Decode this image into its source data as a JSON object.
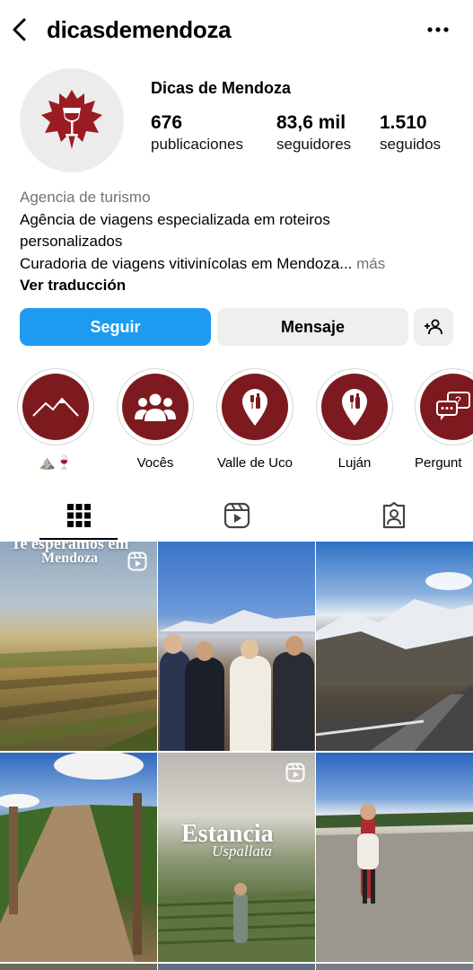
{
  "header": {
    "username": "dicasdemendoza",
    "back_icon": "chevron-left-icon",
    "more_icon": "more-horizontal-icon"
  },
  "profile": {
    "display_name": "Dicas de Mendoza",
    "avatar_icon": "vine-leaf-wine-glass-logo",
    "brand_color": "#9b1c22",
    "stats": {
      "posts_count": "676",
      "posts_label": "publicaciones",
      "followers_count": "83,6 mil",
      "followers_label": "seguidores",
      "following_count": "1.510",
      "following_label": "seguidos"
    },
    "category": "Agencia de turismo",
    "bio_line_1": "Agência de viagens especializada em roteiros",
    "bio_line_2": "personalizados",
    "bio_line_3": "Curadoria de viagens vitivinícolas em Mendoza...",
    "more_label": "más",
    "translate_label": "Ver traducción"
  },
  "actions": {
    "follow_label": "Seguir",
    "follow_color": "#1e9bf0",
    "message_label": "Mensaje",
    "suggest_icon": "add-person-icon"
  },
  "highlights": [
    {
      "label": "⛰️🍷",
      "icon": "mountains-icon"
    },
    {
      "label": "Vocês",
      "icon": "group-icon"
    },
    {
      "label": "Valle de Uco",
      "icon": "map-pin-wine-icon"
    },
    {
      "label": "Luján",
      "icon": "map-pin-wine-icon"
    },
    {
      "label": "Pergunt",
      "icon": "chat-question-icon"
    }
  ],
  "tabs": [
    {
      "name": "posts",
      "icon": "grid-icon",
      "active": true
    },
    {
      "name": "reels",
      "icon": "reels-icon",
      "active": false
    },
    {
      "name": "tagged",
      "icon": "tagged-person-icon",
      "active": false
    }
  ],
  "grid": {
    "post_1_title_a": "Te esperamos em",
    "post_1_title_b": "Mendoza",
    "post_5_title_a": "Estancia",
    "post_5_title_b": "Uspallata"
  }
}
